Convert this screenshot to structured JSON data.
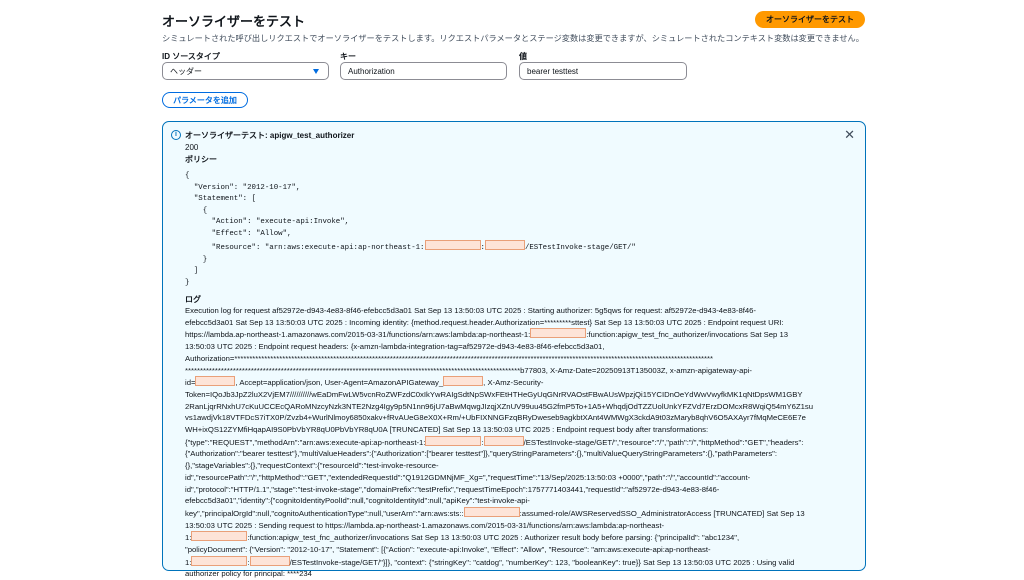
{
  "header": {
    "title": "オーソライザーをテスト",
    "description": "シミュレートされた呼び出しリクエストでオーソライザーをテストします。リクエストパラメータとステージ変数は変更できますが、シミュレートされたコンテキスト変数は変更できません。",
    "test_button": "オーソライザーをテスト"
  },
  "form": {
    "source_type_label": "ID ソースタイプ",
    "source_type_value": "ヘッダー",
    "key_label": "キー",
    "key_value": "Authorization",
    "value_label": "値",
    "value_value": "bearer testtest",
    "add_param_button": "パラメータを追加"
  },
  "result": {
    "title": "オーソライザーテスト: apigw_test_authorizer",
    "status": "200",
    "policy_heading": "ポリシー",
    "policy_lines": [
      "{",
      "  \"Version\": \"2012-10-17\",",
      "  \"Statement\": [",
      "    {",
      "      \"Action\": \"execute-api:Invoke\",",
      "      \"Effect\": \"Allow\",",
      "      \"Resource\": \"arn:aws:execute-api:ap-northeast-1:",
      "    }",
      "  ]",
      "}"
    ],
    "policy_resource_tail": "/ESTestInvoke-stage/GET/\"",
    "log_heading": "ログ",
    "log_lines": [
      "Execution log for request af52972e-d943-4e83-8f46-efebcc5d3a01 Sat Sep 13 13:50:03 UTC 2025 : Starting authorizer: 5g5qws for request: af52972e-d943-4e83-8f46-",
      "efebcc5d3a01 Sat Sep 13 13:50:03 UTC 2025 : Incoming identity: {method.request.header.Authorization=*********sttest} Sat Sep 13 13:50:03 UTC 2025 : Endpoint request URI:",
      "https://lambda.ap-northeast-1.amazonaws.com/2015-03-31/functions/arn:aws:lambda:ap-northeast-1:",
      ":function:apigw_test_fnc_authorizer/invocations Sat Sep 13",
      "13:50:03 UTC 2025 : Endpoint request headers: {x-amzn-lambda-integration-tag=af52972e-d943-4e83-8f46-efebcc5d3a01,",
      "Authorization=****************************************************************************************************************************************************************",
      "****************************************************************************************************************b77803, X-Amz-Date=20250913T135003Z, x-amzn-apigateway-api-",
      "id=",
      ", Accept=application/json, User-Agent=AmazonAPIGateway_",
      ", X-Amz-Security-",
      "Token=IQoJb3JpZ2luX2VjEM7//////////wEaDmFwLW5vcnRoZWFzdC0xIkYwRAIgSdtNpSWxFEtHTHeGyUqGNrRVAOstFBwAUsWpzjQi15YCIDnOeYdWwVwyfkMK1qNtDpsWM1GBY",
      "2RanLjqrRNxhU7cKuUCCEcQARoMNzcyNzk3NTE2Nzg4Igy9p5N1nn96jU7aBwMqwgJIzqjXZnUV99uu45G2fmP5To+1A5+WhqdjOdTZZUolUnkYFZVd7ErzDOMcxR8WqiQ54mY6Z1su",
      "vs1awdjVk18VTFDcS7iTX0P/Zvzb4+WurlNlmoy6850xakv+fRvAUeG8eX0X+Rm/+UbFIXNNGFzqBRyDweseb9agkbtXAnt4WMWgX3ckdA9t03zMaryb8qhV6O5AXAyr7fMqMeCE6E7e",
      "WH+ixQS12ZYMfiHqapAI9S0PbVbYR8qU0PbVbYR8qU0A",
      "{\"type\":\"REQUEST\",\"methodArn\":\"arn:aws:execute-api:ap-northeast-1:",
      "/ESTestInvoke-stage/GET/\",\"resource\":\"/\",\"path\":\"/\",\"httpMethod\":\"GET\",\"headers\":",
      "{\"Authorization\":\"bearer testtest\"},\"multiValueHeaders\":{\"Authorization\":[\"bearer testtest\"]},\"queryStringParameters\":{},\"multiValueQueryStringParameters\":{},\"pathParameters\":",
      "{},\"stageVariables\":{},\"requestContext\":{\"resourceId\":\"test-invoke-resource-",
      "id\",\"resourcePath\":\"/\",\"httpMethod\":\"GET\",\"extendedRequestId\":\"Q1912GDMNjMF_Xg=\",\"requestTime\":\"13/Sep/2025:13:50:03 +0000\",\"path\":\"/\",\"accountId\":\"account-",
      "id\",\"protocol\":\"HTTP/1.1\",\"stage\":\"test-invoke-stage\",\"domainPrefix\":\"testPrefix\",\"requestTimeEpoch\":1757771403441,\"requestId\":\"af52972e-d943-4e83-8f46-",
      "efebcc5d3a01\",\"identity\":{\"cognitoIdentityPoolId\":null,\"cognitoIdentityId\":null,\"apiKey\":\"test-invoke-api-",
      "key\",\"principalOrgId\":null,\"cognitoAuthenticationType\":null,\"userArn\":\"arn:aws:sts::",
      ":assumed-role/AWSReservedSSO_AdministratorAccess [TRUNCATED] Sat Sep 13",
      "13:50:03 UTC 2025 : Sending request to https://lambda.ap-northeast-1.amazonaws.com/2015-03-31/functions/arn:aws:lambda:ap-northeast-",
      "1:",
      ":function:apigw_test_fnc_authorizer/invocations Sat Sep 13 13:50:03 UTC 2025 : Authorizer result body before parsing: {\"principalId\": \"abc1234\",",
      "\"policyDocument\": {\"Version\": \"2012-10-17\", \"Statement\": [{\"Action\": \"execute-api:Invoke\", \"Effect\": \"Allow\", \"Resource\": \"arn:aws:execute-api:ap-northeast-",
      "1:",
      "/ESTestInvoke-stage/GET/\"}]}, \"context\": {\"stringKey\": \"catdog\", \"numberKey\": 123, \"booleanKey\": true}} Sat Sep 13 13:50:03 UTC 2025 : Using valid",
      "authorizer policy for principal: ****234"
    ],
    "log_truncated_line": " [TRUNCATED] Sat Sep 13 13:50:03 UTC 2025 : Endpoint request body after transformations:"
  }
}
